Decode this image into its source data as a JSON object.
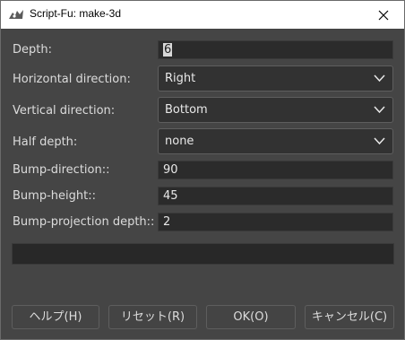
{
  "window": {
    "title": "Script-Fu: make-3d"
  },
  "form": {
    "depth": {
      "label": "Depth:",
      "value": "6"
    },
    "horizontal_direction": {
      "label": "Horizontal direction:",
      "value": "Right"
    },
    "vertical_direction": {
      "label": "Vertical direction:",
      "value": "Bottom"
    },
    "half_depth": {
      "label": "Half depth:",
      "value": "none"
    },
    "bump_direction": {
      "label": "Bump-direction::",
      "value": "90"
    },
    "bump_height": {
      "label": "Bump-height::",
      "value": "45"
    },
    "bump_projection_depth": {
      "label": "Bump-projection depth::",
      "value": "2"
    }
  },
  "buttons": {
    "help": "ヘルプ(H)",
    "reset": "リセット(R)",
    "ok": "OK(O)",
    "cancel": "キャンセル(C)"
  },
  "icons": {
    "app": "gimp-wilber-icon",
    "close": "close-icon",
    "chevron": "chevron-down-icon"
  }
}
